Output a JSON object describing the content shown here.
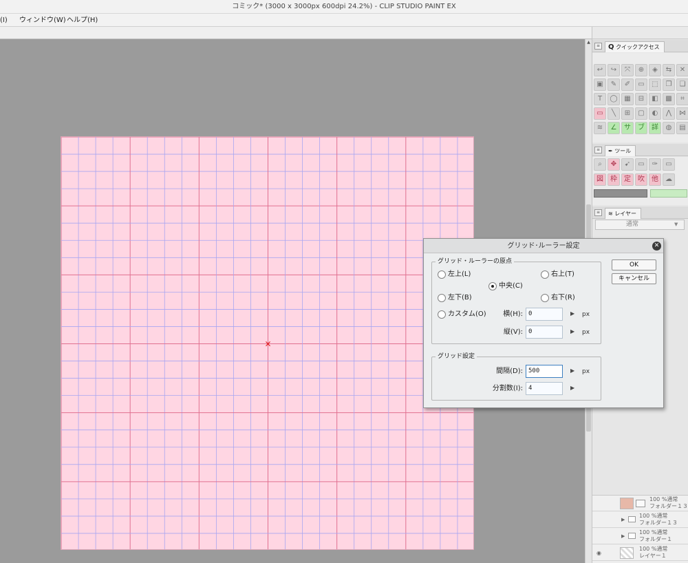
{
  "window": {
    "title": "コミック* (3000 x 3000px 600dpi 24.2%)  - CLIP STUDIO PAINT EX"
  },
  "menu": {
    "items": [
      "(I)",
      "ウィンドウ(W)",
      "ヘルプ(H)"
    ]
  },
  "panels": {
    "quick_access_tab": "クイックアクセス",
    "tool_tab": "ツール",
    "layer_tab": "レイヤー",
    "blend_mode": "通常",
    "layers": [
      {
        "opacity": "100 %通常",
        "name": "フォルダー１３"
      },
      {
        "opacity": "100 %通常",
        "name": "フォルダー１３"
      },
      {
        "opacity": "100 %通常",
        "name": "フォルダー１"
      },
      {
        "opacity": "100 %通常",
        "name": "レイヤー１"
      }
    ]
  },
  "dialog": {
    "title": "グリッド･ルーラー設定",
    "origin_group": "グリッド・ルーラーの原点",
    "origin_options": {
      "top_left": "左上(L)",
      "top_right": "右上(T)",
      "center": "中央(C)",
      "bottom_left": "左下(B)",
      "bottom_right": "右下(R)",
      "custom": "カスタム(O)"
    },
    "selected_origin": "center",
    "horizontal": {
      "label": "横(H):",
      "value": "0",
      "unit": "px"
    },
    "vertical": {
      "label": "縦(V):",
      "value": "0",
      "unit": "px"
    },
    "grid_group": "グリッド設定",
    "gap": {
      "label": "間隔(D):",
      "value": "500",
      "unit": "px"
    },
    "divisions": {
      "label": "分割数(I):",
      "value": "4"
    },
    "ok_label": "OK",
    "cancel_label": "キャンセル"
  },
  "canvas": {
    "paper_color": "#ffd6e3",
    "grid_major_color": "#e07090",
    "grid_minor_color": "#a8a6f2",
    "origin_marker_color": "#e01010"
  }
}
